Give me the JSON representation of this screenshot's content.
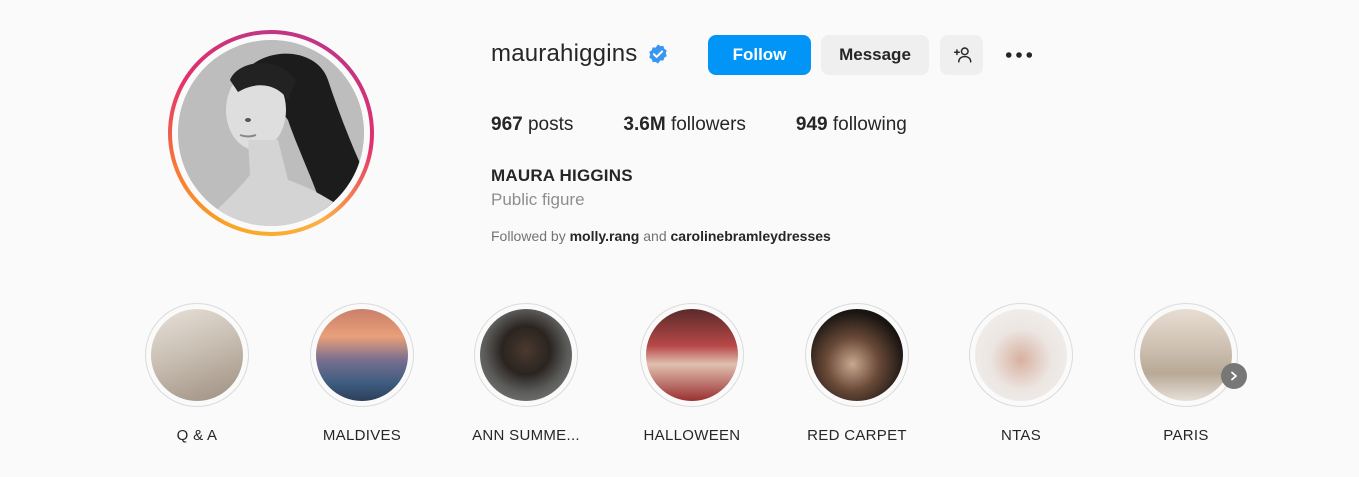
{
  "profile": {
    "username": "maurahiggins",
    "verified": true,
    "full_name": "MAURA HIGGINS",
    "category": "Public figure",
    "followed_by_prefix": "Followed by",
    "followed_by_user1": "molly.rang",
    "followed_by_and": "and",
    "followed_by_user2": "carolinebramleydresses"
  },
  "actions": {
    "follow_label": "Follow",
    "message_label": "Message",
    "add_user_icon": "+person-icon",
    "more_icon": "more-horizontal-icon"
  },
  "stats": {
    "posts_count": "967",
    "posts_label": "posts",
    "followers_count": "3.6M",
    "followers_label": "followers",
    "following_count": "949",
    "following_label": "following"
  },
  "highlights": [
    {
      "label": "Q & A"
    },
    {
      "label": "MALDIVES"
    },
    {
      "label": "ANN SUMME..."
    },
    {
      "label": "HALLOWEEN"
    },
    {
      "label": "RED CARPET"
    },
    {
      "label": "NTAS"
    },
    {
      "label": "PARIS"
    }
  ],
  "colors": {
    "accent": "#0095f6",
    "verified": "#3897f0",
    "secondary_button": "#efefef",
    "muted_text": "#8e8e8e"
  }
}
